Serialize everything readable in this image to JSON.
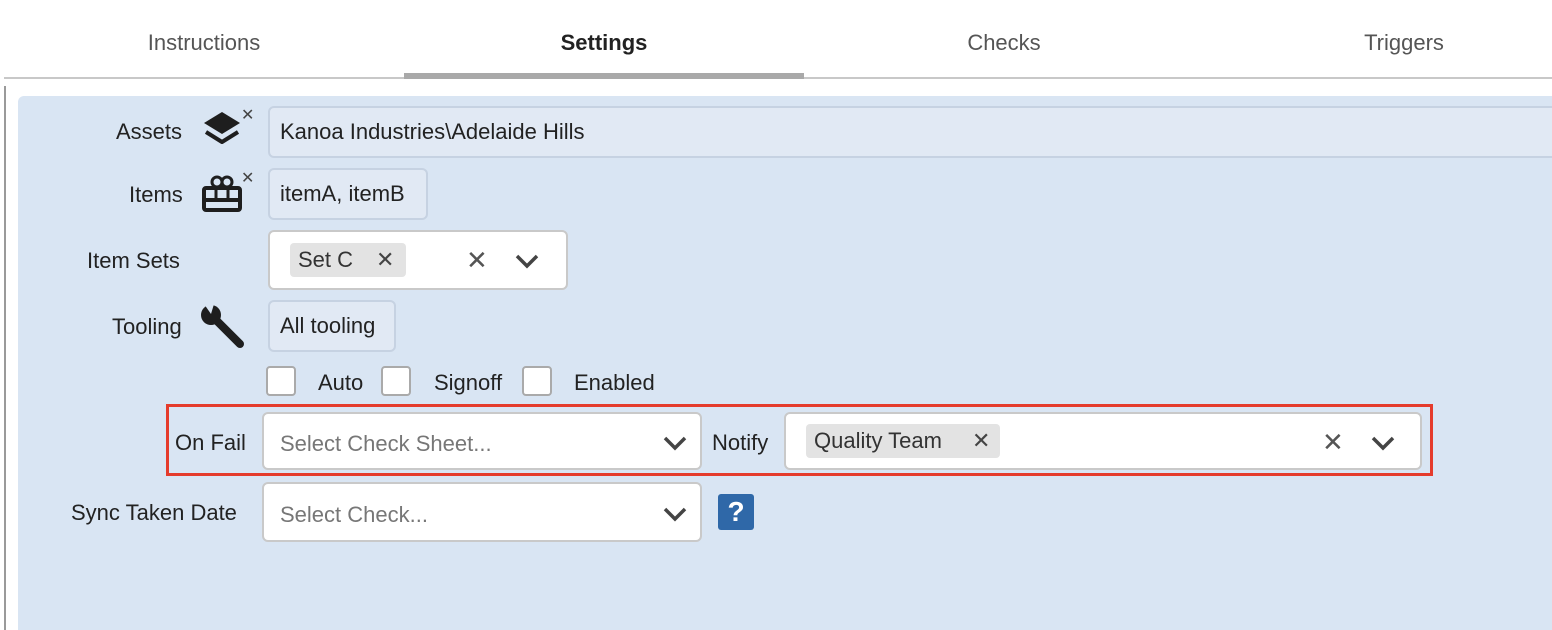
{
  "tabs": [
    {
      "label": "Instructions"
    },
    {
      "label": "Settings"
    },
    {
      "label": "Checks"
    },
    {
      "label": "Triggers"
    }
  ],
  "active_tab": "Settings",
  "form": {
    "assets": {
      "label": "Assets",
      "value": "Kanoa Industries\\Adelaide Hills",
      "icon": "layers-icon"
    },
    "items": {
      "label": "Items",
      "value": "itemA, itemB",
      "icon": "gift-icon"
    },
    "item_sets": {
      "label": "Item Sets",
      "chips": [
        "Set C"
      ]
    },
    "tooling": {
      "label": "Tooling",
      "value": "All tooling",
      "icon": "wrench-icon"
    },
    "checkboxes": [
      {
        "label": "Auto",
        "checked": false
      },
      {
        "label": "Signoff",
        "checked": false
      },
      {
        "label": "Enabled",
        "checked": false
      }
    ],
    "on_fail": {
      "label": "On Fail",
      "placeholder": "Select Check Sheet..."
    },
    "notify": {
      "label": "Notify",
      "chips": [
        "Quality Team"
      ]
    },
    "sync_taken_date": {
      "label": "Sync Taken Date",
      "placeholder": "Select Check...",
      "help": "?"
    }
  },
  "colors": {
    "panel": "#d9e5f3",
    "highlight": "#e53b2c",
    "help_button": "#2f68a8"
  }
}
